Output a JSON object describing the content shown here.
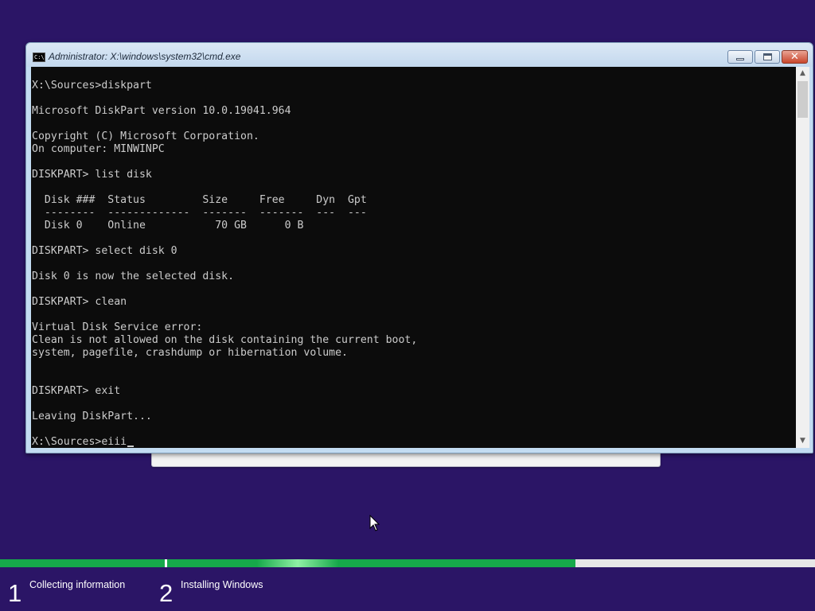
{
  "window": {
    "title": "Administrator: X:\\windows\\system32\\cmd.exe",
    "icon": "cmd-icon",
    "icon_text": "C:\\",
    "close_glyph": "✕"
  },
  "console": {
    "lines": [
      "X:\\Sources>diskpart",
      "",
      "Microsoft DiskPart version 10.0.19041.964",
      "",
      "Copyright (C) Microsoft Corporation.",
      "On computer: MINWINPC",
      "",
      "DISKPART> list disk",
      "",
      "  Disk ###  Status         Size     Free     Dyn  Gpt",
      "  --------  -------------  -------  -------  ---  ---",
      "  Disk 0    Online           70 GB      0 B",
      "",
      "DISKPART> select disk 0",
      "",
      "Disk 0 is now the selected disk.",
      "",
      "DISKPART> clean",
      "",
      "Virtual Disk Service error:",
      "Clean is not allowed on the disk containing the current boot,",
      "system, pagefile, crashdump or hibernation volume.",
      "",
      "",
      "DISKPART> exit",
      "",
      "Leaving DiskPart...",
      ""
    ],
    "prompt_line": "X:\\Sources>eiii",
    "background": "#0c0c0c",
    "foreground": "#cccccc"
  },
  "scrollbar": {
    "up_arrow": "▲",
    "down_arrow": "▼"
  },
  "setup": {
    "progress": {
      "step1_fraction": 1.0,
      "step2_fraction": 0.63,
      "color": "#16a84a"
    },
    "steps": [
      {
        "number": "1",
        "label": "Collecting information"
      },
      {
        "number": "2",
        "label": "Installing Windows"
      }
    ],
    "background": "#2b1566"
  }
}
